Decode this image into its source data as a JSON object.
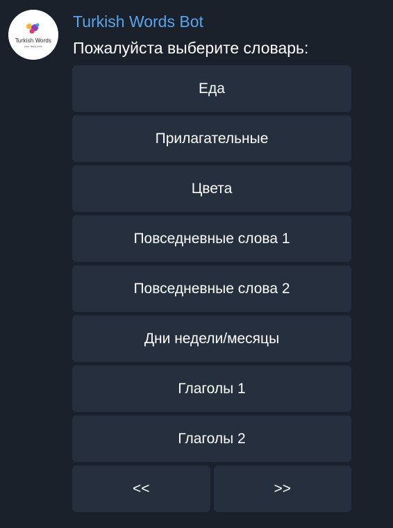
{
  "bot": {
    "name": "Turkish Words Bot",
    "avatar_text": "Turkish Words",
    "avatar_subtext": "your daily plan"
  },
  "message": {
    "text": "Пожалуйста выберите словарь:"
  },
  "keyboard": {
    "rows": [
      [
        "Еда"
      ],
      [
        "Прилагательные"
      ],
      [
        "Цвета"
      ],
      [
        "Повседневные слова 1"
      ],
      [
        "Повседневные слова 2"
      ],
      [
        "Дни недели/месяцы"
      ],
      [
        "Глаголы 1"
      ],
      [
        "Глаголы 2"
      ],
      [
        "<<",
        ">>"
      ]
    ]
  },
  "colors": {
    "background": "#1b212b",
    "button": "#252f3e",
    "sender_name": "#5aa5ea",
    "text": "#ffffff"
  }
}
